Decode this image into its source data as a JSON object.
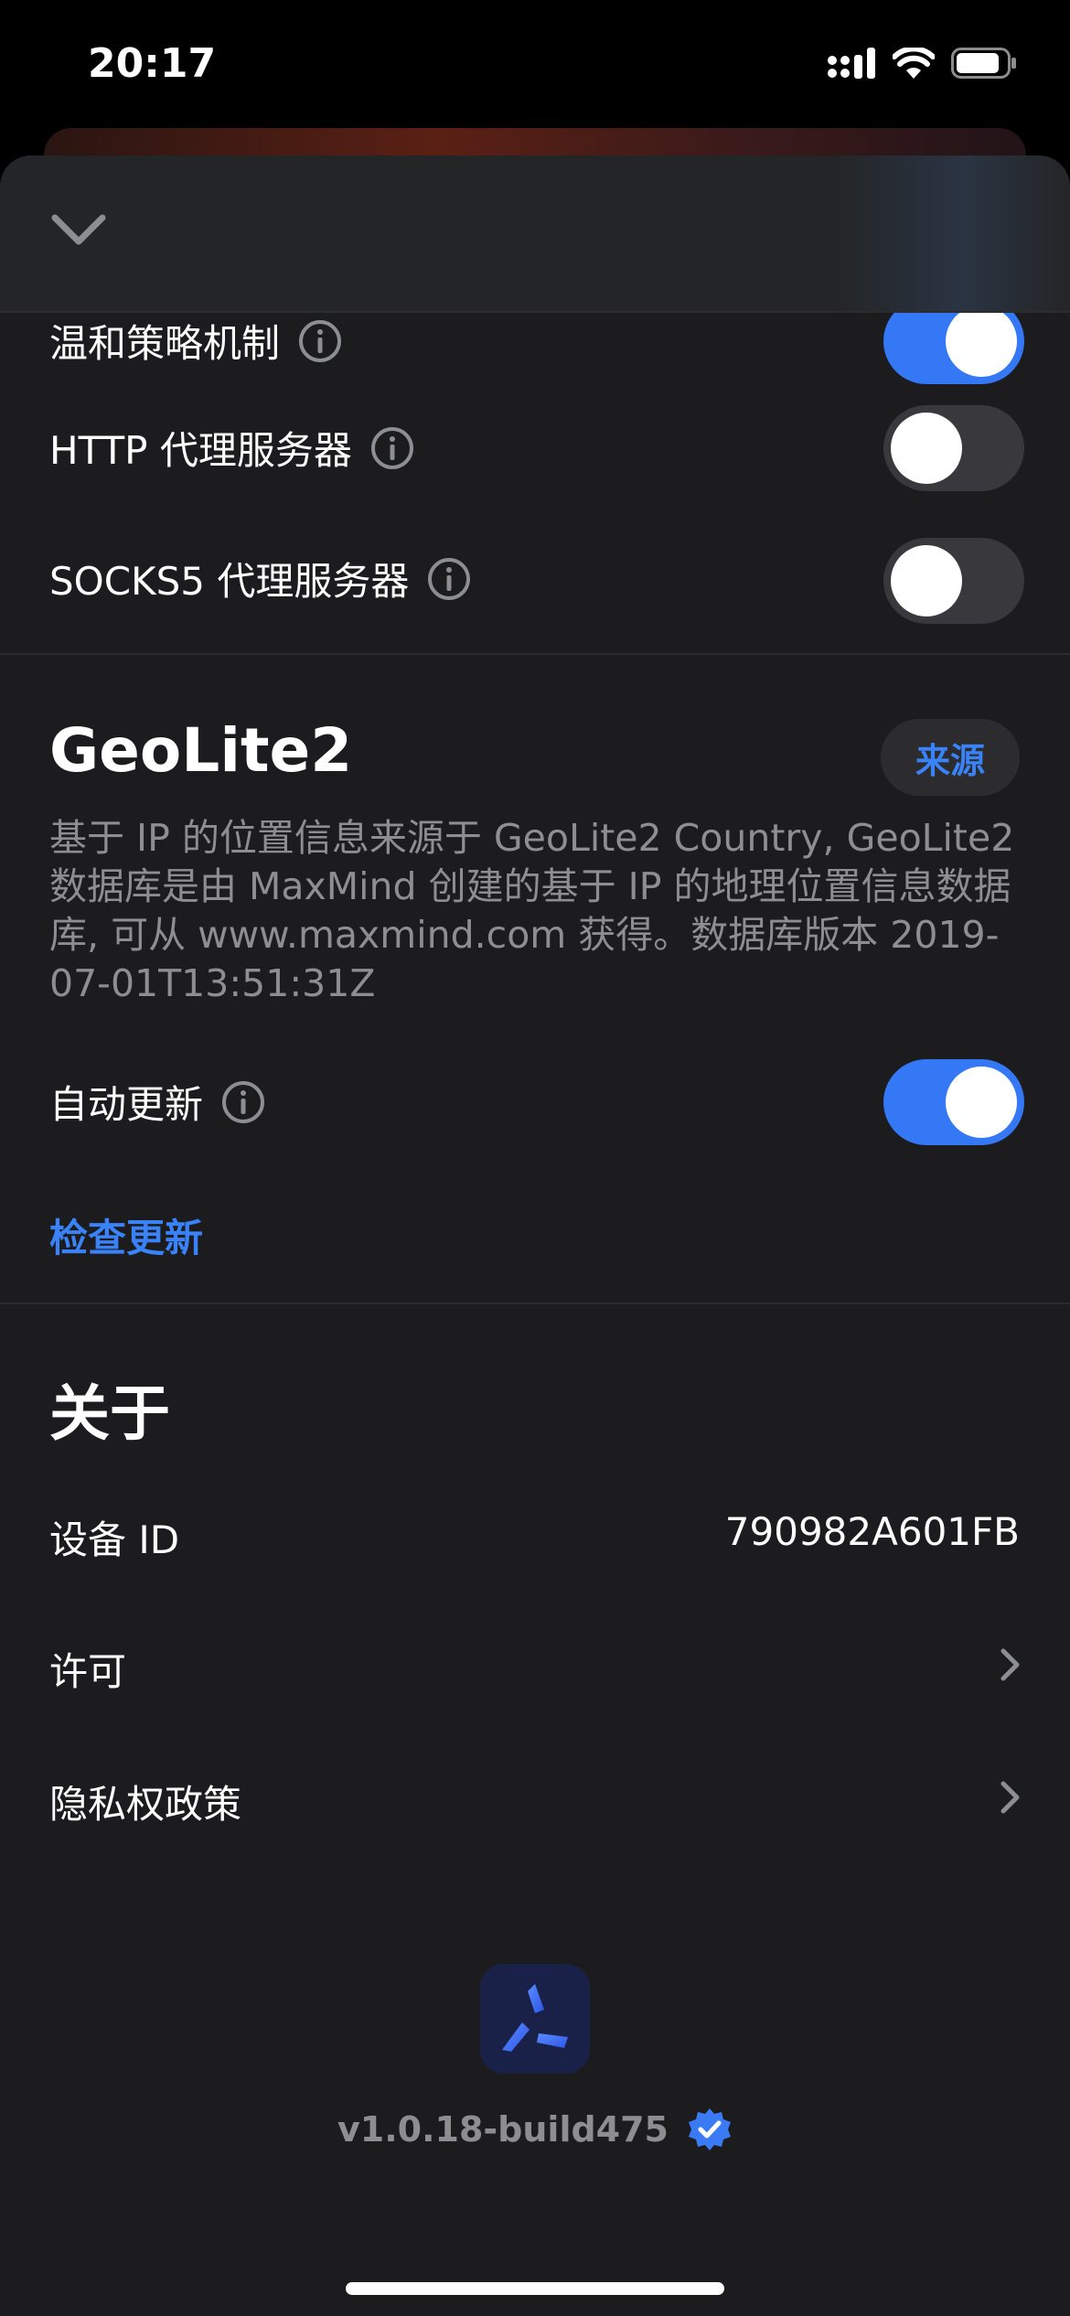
{
  "status": {
    "time": "20:17"
  },
  "settings": {
    "gentle_policy": {
      "label": "温和策略机制",
      "enabled": true
    },
    "http_proxy": {
      "label": "HTTP 代理服务器",
      "enabled": false
    },
    "socks5_proxy": {
      "label": "SOCKS5 代理服务器",
      "enabled": false
    }
  },
  "geolite": {
    "title": "GeoLite2",
    "source_button": "来源",
    "description": "基于 IP 的位置信息来源于 GeoLite2 Country, GeoLite2 数据库是由 MaxMind 创建的基于 IP 的地理位置信息数据库, 可从 www.maxmind.com 获得。数据库版本 2019-07-01T13:51:31Z",
    "auto_update": {
      "label": "自动更新",
      "enabled": true
    },
    "check_update": "检查更新"
  },
  "about": {
    "title": "关于",
    "device_id_label": "设备 ID",
    "device_id": "790982A601FB",
    "license": "许可",
    "privacy": "隐私权政策"
  },
  "footer": {
    "version": "v1.0.18-build475"
  },
  "colors": {
    "accent": "#3478f6",
    "sheet_bg": "#1c1c1e",
    "secondary_text": "#8d8d92"
  },
  "icons": [
    "chevron-down-icon",
    "info-icon",
    "chevron-right-icon",
    "verified-badge-icon",
    "app-logo-icon",
    "signal-icon",
    "wifi-icon",
    "battery-icon"
  ]
}
